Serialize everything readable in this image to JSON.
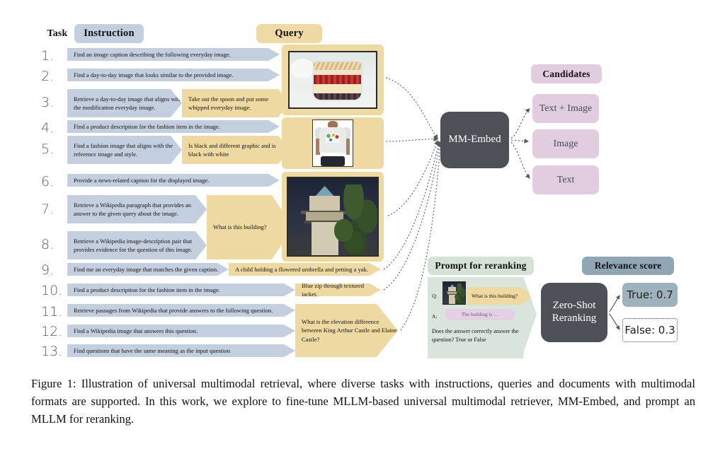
{
  "headers": {
    "task": "Task",
    "instruction": "Instruction",
    "query": "Query",
    "candidates": "Candidates",
    "prompt_for_reranking": "Prompt for reranking",
    "relevance_score": "Relevance score"
  },
  "colors": {
    "instruction_blue": "#c3cede",
    "query_gold": "#eed9a3",
    "candidate_purple": "#e2cde0",
    "dark_box": "#4d5157",
    "prompt_green": "#d5e3d6",
    "relevance_slate": "#90a7b3"
  },
  "tasks": [
    {
      "num": "1.",
      "instruction": "Find an image caption describing the following everyday image.",
      "query": ""
    },
    {
      "num": "2.",
      "instruction": "Find a day-to-day image that looks similar to the provided image.",
      "query": ""
    },
    {
      "num": "3.",
      "instruction": "Retrieve a day-to-day image that aligns with the modification everyday image.",
      "query": "Take out the spoon and put some whipped everyday image."
    },
    {
      "num": "4.",
      "instruction": "Find a product description for the fashion item in the image.",
      "query": ""
    },
    {
      "num": "5.",
      "instruction": "Find a fashion image that aligns with the reference image and style.",
      "query": "Is black and different graphic and is black with white"
    },
    {
      "num": "6.",
      "instruction": "Provide a news-related caption for the displayed image.",
      "query": ""
    },
    {
      "num": "7.",
      "instruction": "Retrieve a Wikipedia paragraph that provides an answer to the given query about the image.",
      "query": "What is this building?"
    },
    {
      "num": "8.",
      "instruction": "Retrieve a Wikipedia image-description pair that provides evidence for the question of this image.",
      "query": ""
    },
    {
      "num": "9.",
      "instruction": "Find me an everyday image that matches the given caption.",
      "query": "A child holding a flowered umbrella and petting a yak."
    },
    {
      "num": "10.",
      "instruction": "Find a product description for the fashion item in the image.",
      "query": "Blue zip through textured jacket."
    },
    {
      "num": "11.",
      "instruction": "Retrieve passages from Wikipedia that provide answers to the following question.",
      "query": "What is the elevation difference between King Arthur Castle and Elaine Castle?"
    },
    {
      "num": "12.",
      "instruction": "Find a Wikipedia image that answers this question.",
      "query": ""
    },
    {
      "num": "13.",
      "instruction": "Find questions that have the same meaning as the input question",
      "query": ""
    }
  ],
  "model": {
    "embed_label": "MM-Embed",
    "reranker_label_line1": "Zero-Shot",
    "reranker_label_line2": "Reranking"
  },
  "candidates": [
    {
      "label": "Text + Image"
    },
    {
      "label": "Image"
    },
    {
      "label": "Text"
    }
  ],
  "scores": [
    {
      "label": "True: 0.7"
    },
    {
      "label": "False: 0.3"
    }
  ],
  "prompt_panel": {
    "q_label": "Q:",
    "a_label": "A:",
    "question": "What is this building?",
    "answer": "The building is …",
    "ask_line1": "Does the answer correctly answer the",
    "ask_line2": "question? True or False"
  },
  "caption": "Figure 1: Illustration of universal multimodal retrieval, where diverse tasks with instructions, queries and documents with multimodal formats are supported.  In this work, we explore to fine-tune MLLM-based universal multimodal retriever, MM-Embed, and prompt an MLLM for reranking."
}
